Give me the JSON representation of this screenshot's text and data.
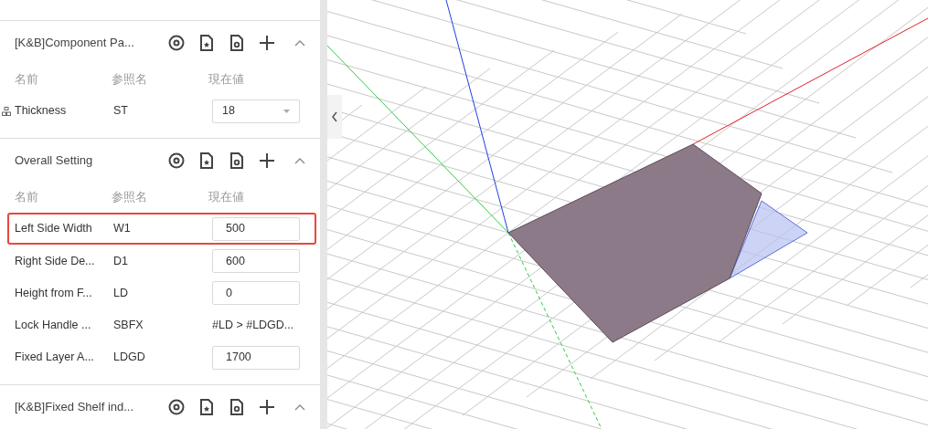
{
  "sections": [
    {
      "title": "[K&B]Component Pa...",
      "expanded": true,
      "columns": [
        "名前",
        "参照名",
        "現在値"
      ],
      "params": [
        {
          "name": "Thickness",
          "ref": "ST",
          "value": "18",
          "kind": "select",
          "linked": true,
          "highlighted": false
        }
      ]
    },
    {
      "title": "Overall Setting",
      "expanded": true,
      "columns": [
        "名前",
        "参照名",
        "現在値"
      ],
      "params": [
        {
          "name": "Left Side Width",
          "ref": "W1",
          "value": "500",
          "kind": "input",
          "linked": false,
          "highlighted": true
        },
        {
          "name": "Right Side De...",
          "ref": "D1",
          "value": "600",
          "kind": "input",
          "linked": false,
          "highlighted": false
        },
        {
          "name": "Height from F...",
          "ref": "LD",
          "value": "0",
          "kind": "input",
          "linked": false,
          "highlighted": false
        },
        {
          "name": "Lock Handle ...",
          "ref": "SBFX",
          "value": "#LD > #LDGD...",
          "kind": "text",
          "linked": false,
          "highlighted": false
        },
        {
          "name": "Fixed Layer A...",
          "ref": "LDGD",
          "value": "1700",
          "kind": "input",
          "linked": false,
          "highlighted": false
        }
      ]
    },
    {
      "title": "[K&B]Fixed Shelf ind...",
      "expanded": true
    }
  ]
}
